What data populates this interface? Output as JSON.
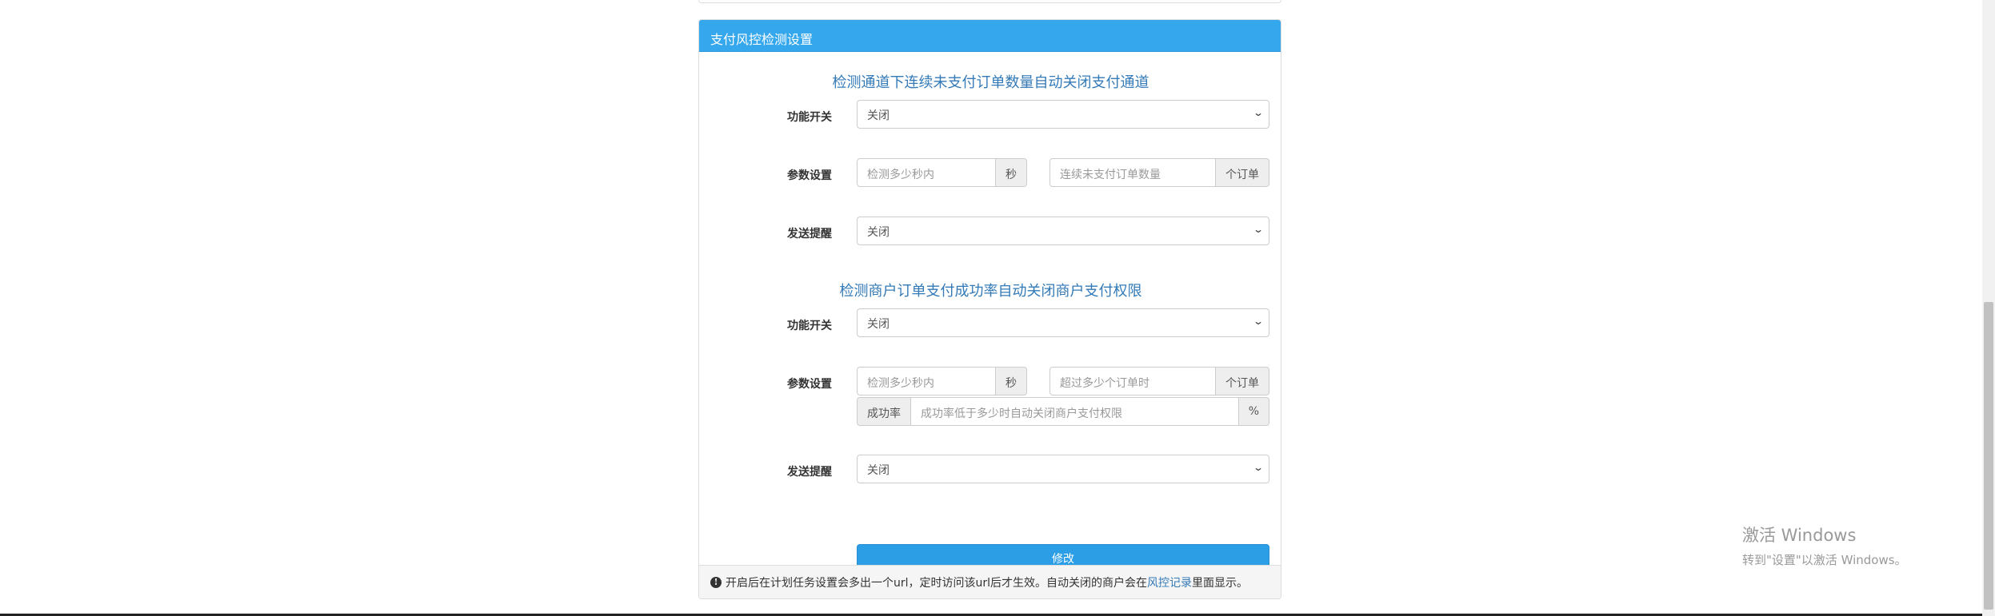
{
  "panel": {
    "heading": "支付风控检测设置",
    "section1": {
      "title": "检测通道下连续未支付订单数量自动关闭支付通道",
      "switch_label": "功能开关",
      "switch_value": "关闭",
      "params_label": "参数设置",
      "seconds_placeholder": "检测多少秒内",
      "seconds_unit": "秒",
      "count_placeholder": "连续未支付订单数量",
      "count_unit": "个订单",
      "notify_label": "发送提醒",
      "notify_value": "关闭"
    },
    "section2": {
      "title": "检测商户订单支付成功率自动关闭商户支付权限",
      "switch_label": "功能开关",
      "switch_value": "关闭",
      "params_label": "参数设置",
      "seconds_placeholder": "检测多少秒内",
      "seconds_unit": "秒",
      "count_placeholder": "超过多少个订单时",
      "count_unit": "个订单",
      "rate_prefix": "成功率",
      "rate_placeholder": "成功率低于多少时自动关闭商户支付权限",
      "rate_unit": "%",
      "notify_label": "发送提醒",
      "notify_value": "关闭"
    },
    "submit_label": "修改",
    "footer": {
      "icon": "info-icon",
      "text_before": "开启后在计划任务设置会多出一个url，定时访问该url后才生效。自动关闭的商户会在",
      "link": "风控记录",
      "text_after": "里面显示。"
    }
  },
  "watermark": {
    "line1": "激活 Windows",
    "line2": "转到\"设置\"以激活 Windows。"
  },
  "colors": {
    "heading_bg": "#35a7ec",
    "title_blue": "#337ab7",
    "button_bg": "#2b9ee6"
  }
}
